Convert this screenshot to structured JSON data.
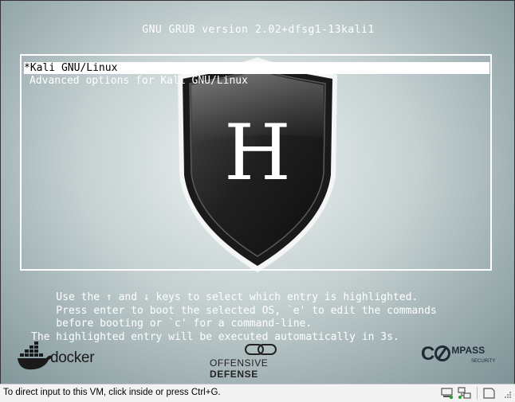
{
  "grub": {
    "title": "GNU GRUB  version 2.02+dfsg1-13kali1",
    "entries": [
      {
        "label": "*Kali GNU/Linux",
        "selected": true
      },
      {
        "label": "Advanced options for Kali GNU/Linux",
        "selected": false
      }
    ],
    "help": {
      "line1": "    Use the ↑ and ↓ keys to select which entry is highlighted.",
      "line2": "    Press enter to boot the selected OS, `e' to edit the commands",
      "line3": "    before booting or `c' for a command-line.",
      "line4": "The highlighted entry will be executed automatically in 3s."
    },
    "emblem_letter": "H"
  },
  "logos": {
    "docker": "docker",
    "offensive_defense_1": "OFFENSIVE ",
    "offensive_defense_2": "DEFENSE",
    "compass_1": "C",
    "compass_2": "MPASS",
    "compass_sub": "SECURITY"
  },
  "statusbar": {
    "text": "To direct input to this VM, click inside or press Ctrl+G."
  },
  "colors": {
    "highlight": "#ffffff",
    "text": "#ffffff",
    "status_bg": "#f3f3f3"
  }
}
